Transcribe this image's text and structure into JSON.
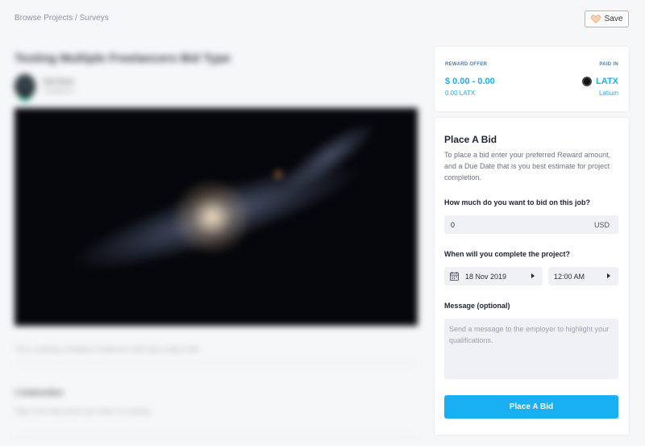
{
  "breadcrumb": {
    "parent": "Browse Projects",
    "separator": " / ",
    "current": "Surveys"
  },
  "save_button": {
    "label": "Save",
    "icon": "heart-icon",
    "accent": "#f0a06a"
  },
  "project": {
    "title": "Testing Multiple Freelancers Bid Type",
    "user_name": "Mia Bodo",
    "user_sub": "Freelancer",
    "description": "This is testing a Multiple Freelancers Bid type project with",
    "instructions_title": "1 Instruction",
    "instructions_text": "Take a the document and write it in writing"
  },
  "reward": {
    "label": "REWARD OFFER",
    "amount": "$ 0.00 - 0.00",
    "amount_latx": "0.00 LATX",
    "paid_label": "PAID IN",
    "currency": "LATX",
    "currency_name": "Latium",
    "accent": "#1ab0ee"
  },
  "bid": {
    "title": "Place A Bid",
    "description": "To place a bid enter your preferred Reward amount, and a Due Date that is you best estimate for project completion.",
    "amount_question": "How much do you want to bid on this job?",
    "amount_value": "0",
    "amount_unit": "USD",
    "date_question": "When will you complete the project?",
    "date_value": "18 Nov 2019",
    "time_value": "12:00 AM",
    "message_label": "Message (optional)",
    "message_placeholder": "Send a message to the employer to highlight your qualifications.",
    "submit_label": "Place A Bid",
    "submit_color": "#18b0f3"
  }
}
